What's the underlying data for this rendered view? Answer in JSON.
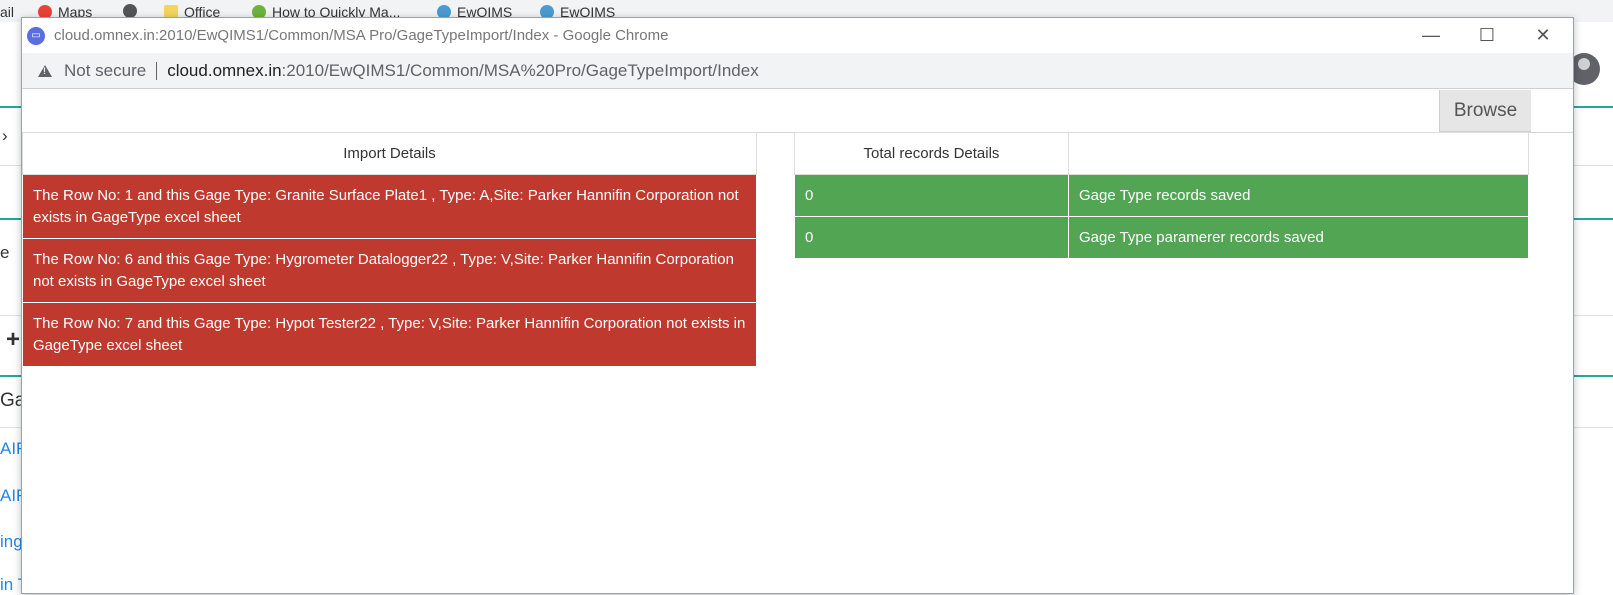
{
  "bookmarks": [
    {
      "label": "ail",
      "icon": "text-fragment"
    },
    {
      "label": "Maps",
      "icon": "google-maps-icon"
    },
    {
      "label": "",
      "icon": "globe-icon"
    },
    {
      "label": "Office",
      "icon": "folder-icon"
    },
    {
      "label": "How to Quickly Ma...",
      "icon": "leaf-icon"
    },
    {
      "label": "EwQIMS",
      "icon": "ewqims-icon"
    },
    {
      "label": "EwQIMS",
      "icon": "ewqims-icon"
    }
  ],
  "background_page": {
    "chevron": "›",
    "partial_letter": "e",
    "plus": "+",
    "partial_heading": "Gag",
    "partial_links": [
      "AIR",
      "AIR",
      "ing",
      "in T"
    ]
  },
  "window": {
    "title": "cloud.omnex.in:2010/EwQIMS1/Common/MSA Pro/GageTypeImport/Index - Google Chrome",
    "minimize": "—",
    "maximize": "☐",
    "close": "✕"
  },
  "address_bar": {
    "security_label": "Not secure",
    "url_host": "cloud.omnex.in",
    "url_path": ":2010/EwQIMS1/Common/MSA%20Pro/GageTypeImport/Index"
  },
  "file_upload": {
    "value": "",
    "browse_label": "Browse"
  },
  "import_details": {
    "header": "Import Details",
    "rows": [
      "The Row No: 1 and this Gage Type: Granite Surface Plate1 , Type: A,Site: Parker Hannifin Corporation not exists in GageType excel sheet",
      "The Row No: 6 and this Gage Type: Hygrometer Datalogger22 , Type: V,Site: Parker Hannifin Corporation not exists in GageType excel sheet",
      "The Row No: 7 and this Gage Type: Hypot Tester22 , Type: V,Site: Parker Hannifin Corporation not exists in GageType excel sheet"
    ]
  },
  "records_details": {
    "header": "Total records Details",
    "header2": "",
    "rows": [
      {
        "count": "0",
        "label": "Gage Type records saved"
      },
      {
        "count": "0",
        "label": "Gage Type paramerer records saved"
      }
    ]
  },
  "colors": {
    "error": "#c0392f",
    "success": "#52a552",
    "accent": "#26a69a",
    "link": "#1e88e5"
  }
}
